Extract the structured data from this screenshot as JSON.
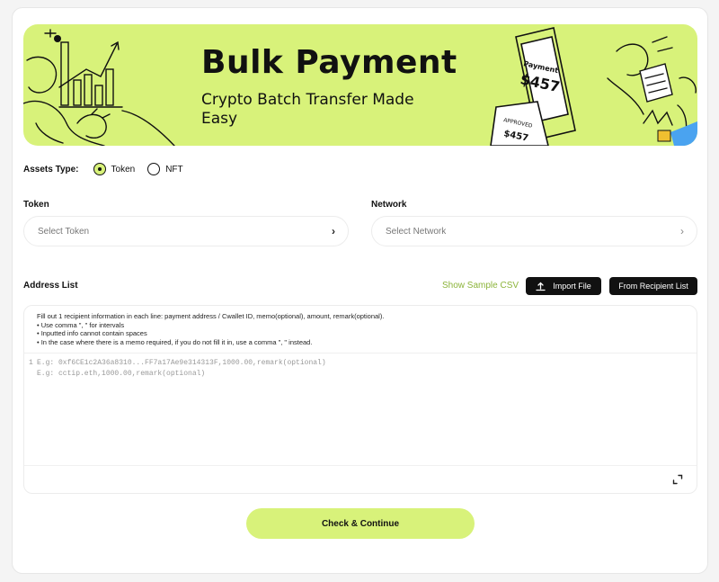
{
  "banner": {
    "title": "Bulk Payment",
    "subtitle": "Crypto Batch Transfer Made Easy",
    "receipt_word": "Payment",
    "receipt_amount": "$457",
    "stub_word": "APPROVED",
    "stub_amount": "$457"
  },
  "assets": {
    "label": "Assets Type:",
    "options": [
      {
        "label": "Token",
        "selected": true
      },
      {
        "label": "NFT",
        "selected": false
      }
    ]
  },
  "token": {
    "label": "Token",
    "placeholder": "Select Token"
  },
  "network": {
    "label": "Network",
    "placeholder": "Select Network"
  },
  "address_list": {
    "label": "Address List",
    "sample_link": "Show Sample CSV",
    "import_button": "Import File",
    "recipient_button": "From Recipient List",
    "instructions": [
      "Fill out 1 recipient information in each line: payment address / Cwallet ID, memo(optional), amount, remark(optional).",
      "• Use comma \", \" for intervals",
      "• Inputted info cannot contain spaces",
      "• In the case where there is a memo required, if you do not fill it in, use a comma \", \" instead."
    ],
    "editor_lines": [
      {
        "number": "1",
        "text": "E.g: 0xf6CE1c2A36a8310...FF7a17Ae9e314313F,1000.00,remark(optional)"
      },
      {
        "number": "",
        "text": "E.g: cctip.eth,1000.00,remark(optional)"
      }
    ]
  },
  "primary_button": "Check & Continue",
  "colors": {
    "accent": "#d8f27a",
    "link": "#8cb43a",
    "dark": "#111111"
  }
}
